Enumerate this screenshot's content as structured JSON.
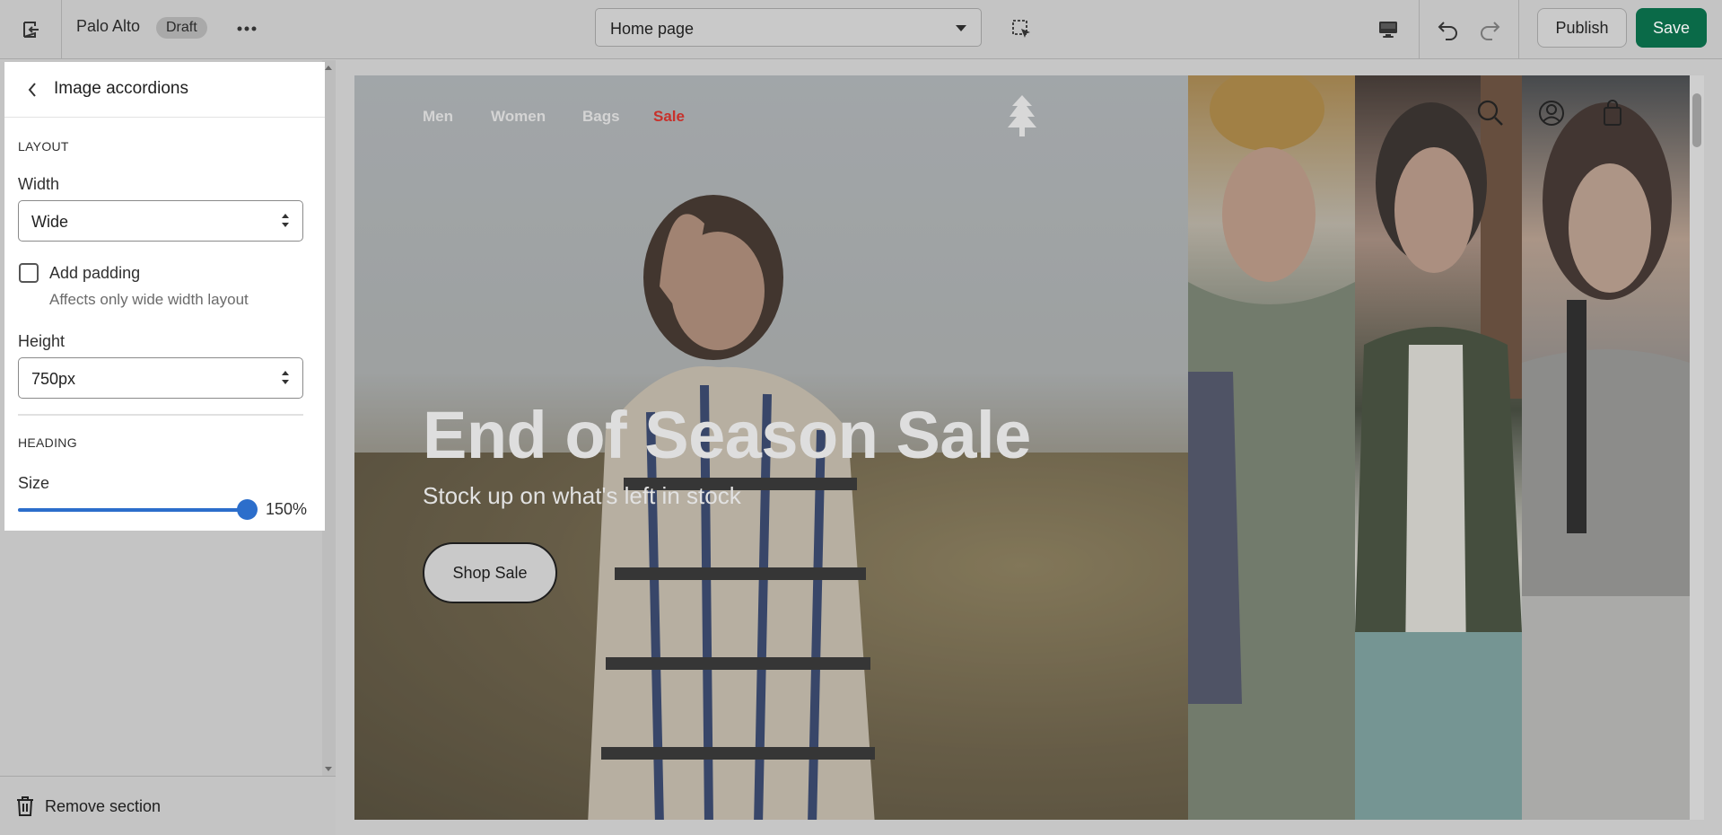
{
  "topbar": {
    "store_name": "Palo Alto",
    "status_badge": "Draft",
    "page_selector": "Home page",
    "publish_label": "Publish",
    "save_label": "Save"
  },
  "panel": {
    "title": "Image accordions",
    "layout_section": "LAYOUT",
    "width_label": "Width",
    "width_value": "Wide",
    "padding_label": "Add padding",
    "padding_checked": false,
    "padding_help": "Affects only wide width layout",
    "height_label": "Height",
    "height_value": "750px",
    "heading_section": "HEADING",
    "size_label": "Size",
    "size_value": "150%",
    "size_fraction": 1.0
  },
  "remove_section": {
    "label": "Remove section"
  },
  "preview": {
    "nav": [
      "Men",
      "Women",
      "Bags",
      "Sale"
    ],
    "heading": "End of Season Sale",
    "subheading": "Stock up on what's left in stock",
    "cta": "Shop Sale"
  },
  "colors": {
    "primary_action": "#0a6a48",
    "slider_accent": "#2c6ecb",
    "sale_link": "#c8302a"
  }
}
